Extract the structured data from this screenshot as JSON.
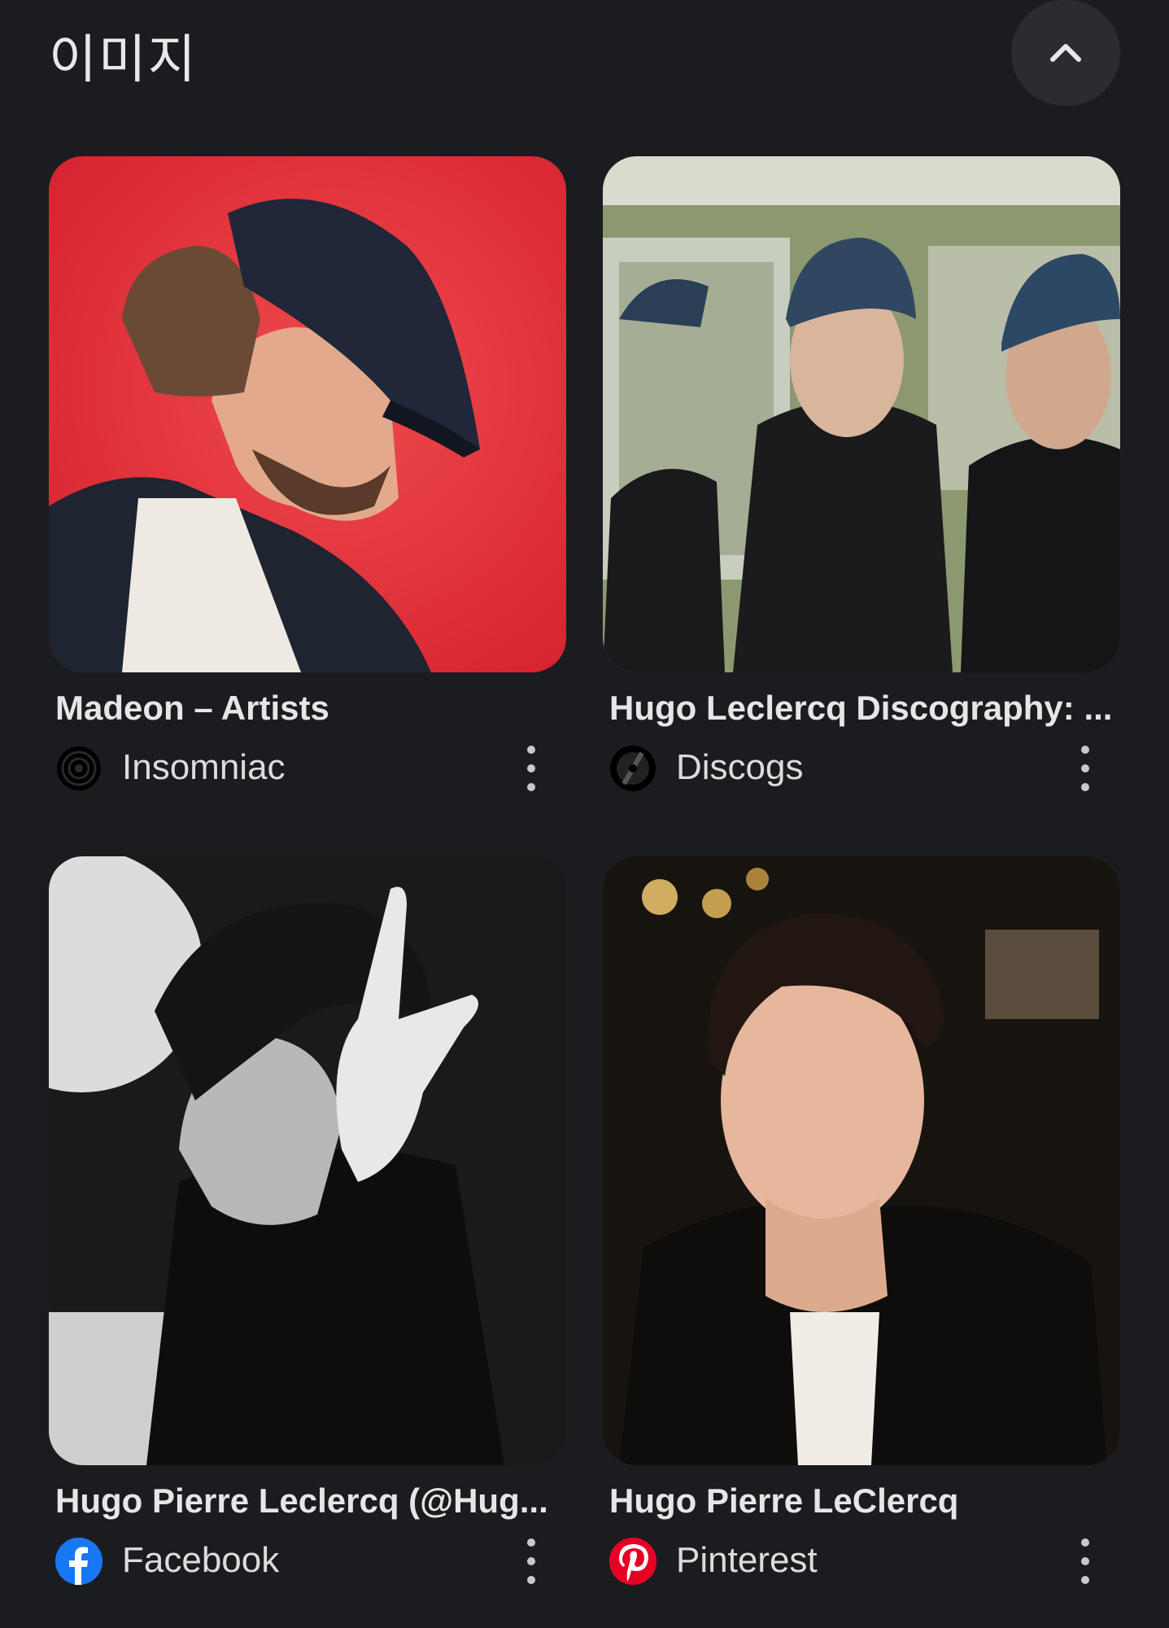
{
  "header": {
    "title": "이미지",
    "collapse_icon": "chevron-up-icon"
  },
  "results": [
    {
      "caption": "Madeon – Artists",
      "source": "Insomniac",
      "favicon": "insomniac-logo-icon",
      "thumb_bg": "#e8323c"
    },
    {
      "caption": "Hugo Leclercq Discography: ...",
      "source": "Discogs",
      "favicon": "discogs-logo-icon",
      "thumb_bg": "#8c9870"
    },
    {
      "caption": "Hugo Pierre Leclercq (@Hug...",
      "source": "Facebook",
      "favicon": "facebook-logo-icon",
      "thumb_bg": "#d8d8d8"
    },
    {
      "caption": "Hugo Pierre LeClercq",
      "source": "Pinterest",
      "favicon": "pinterest-logo-icon",
      "thumb_bg": "#17140f"
    }
  ],
  "colors": {
    "background": "#1b1c1f",
    "facebook": "#1877f2",
    "pinterest": "#e60023"
  }
}
